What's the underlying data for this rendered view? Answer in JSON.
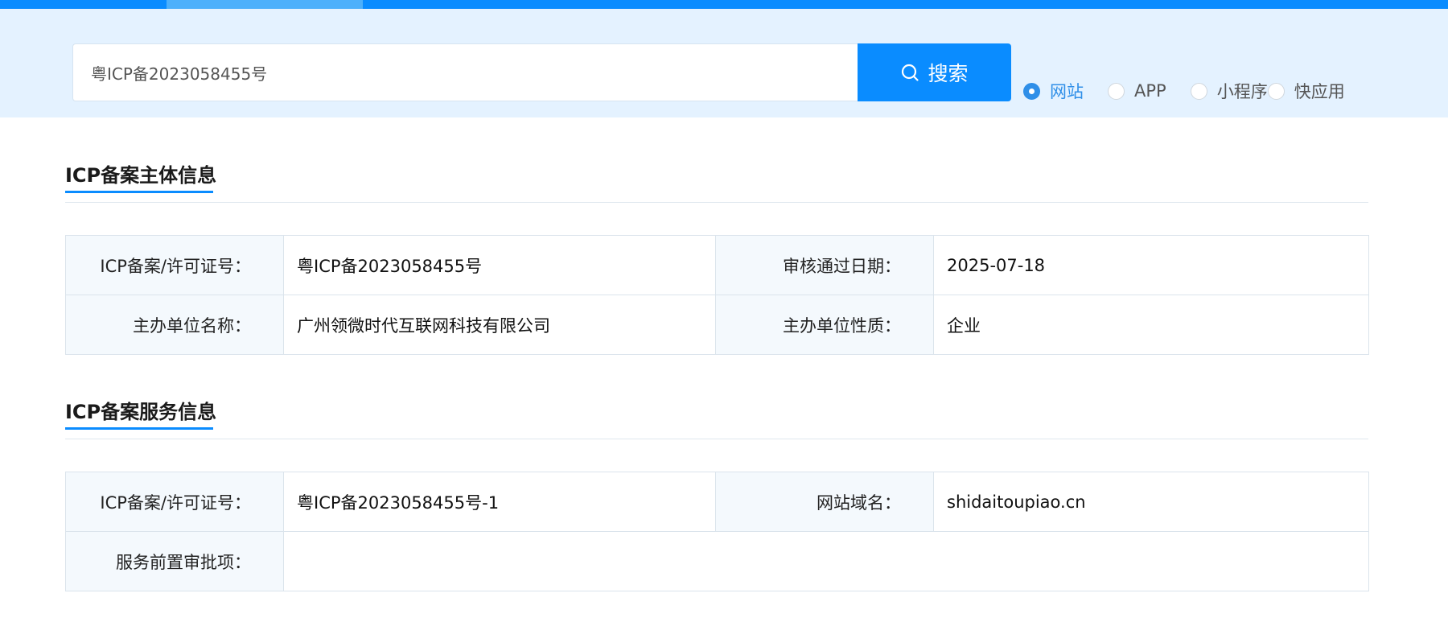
{
  "search": {
    "value": "粤ICP备2023058455号",
    "button_label": "搜索"
  },
  "search_types": [
    {
      "label": "网站",
      "checked": true
    },
    {
      "label": "APP",
      "checked": false
    },
    {
      "label": "小程序",
      "checked": false
    },
    {
      "label": "快应用",
      "checked": false
    }
  ],
  "subject_section": {
    "title": "ICP备案主体信息",
    "rows": [
      {
        "k1": "ICP备案/许可证号：",
        "v1": "粤ICP备2023058455号",
        "k2": "审核通过日期：",
        "v2": "2025-07-18"
      },
      {
        "k1": "主办单位名称：",
        "v1": "广州领微时代互联网科技有限公司",
        "k2": "主办单位性质：",
        "v2": "企业"
      }
    ]
  },
  "service_section": {
    "title": "ICP备案服务信息",
    "row1": {
      "k1": "ICP备案/许可证号：",
      "v1": "粤ICP备2023058455号-1",
      "k2": "网站域名：",
      "v2": "shidaitoupiao.cn"
    },
    "row2": {
      "k1": "服务前置审批项：",
      "v1": ""
    }
  },
  "colors": {
    "accent": "#0a8cff",
    "band": "#e4f2ff",
    "key_cell": "#f4f9fd"
  }
}
